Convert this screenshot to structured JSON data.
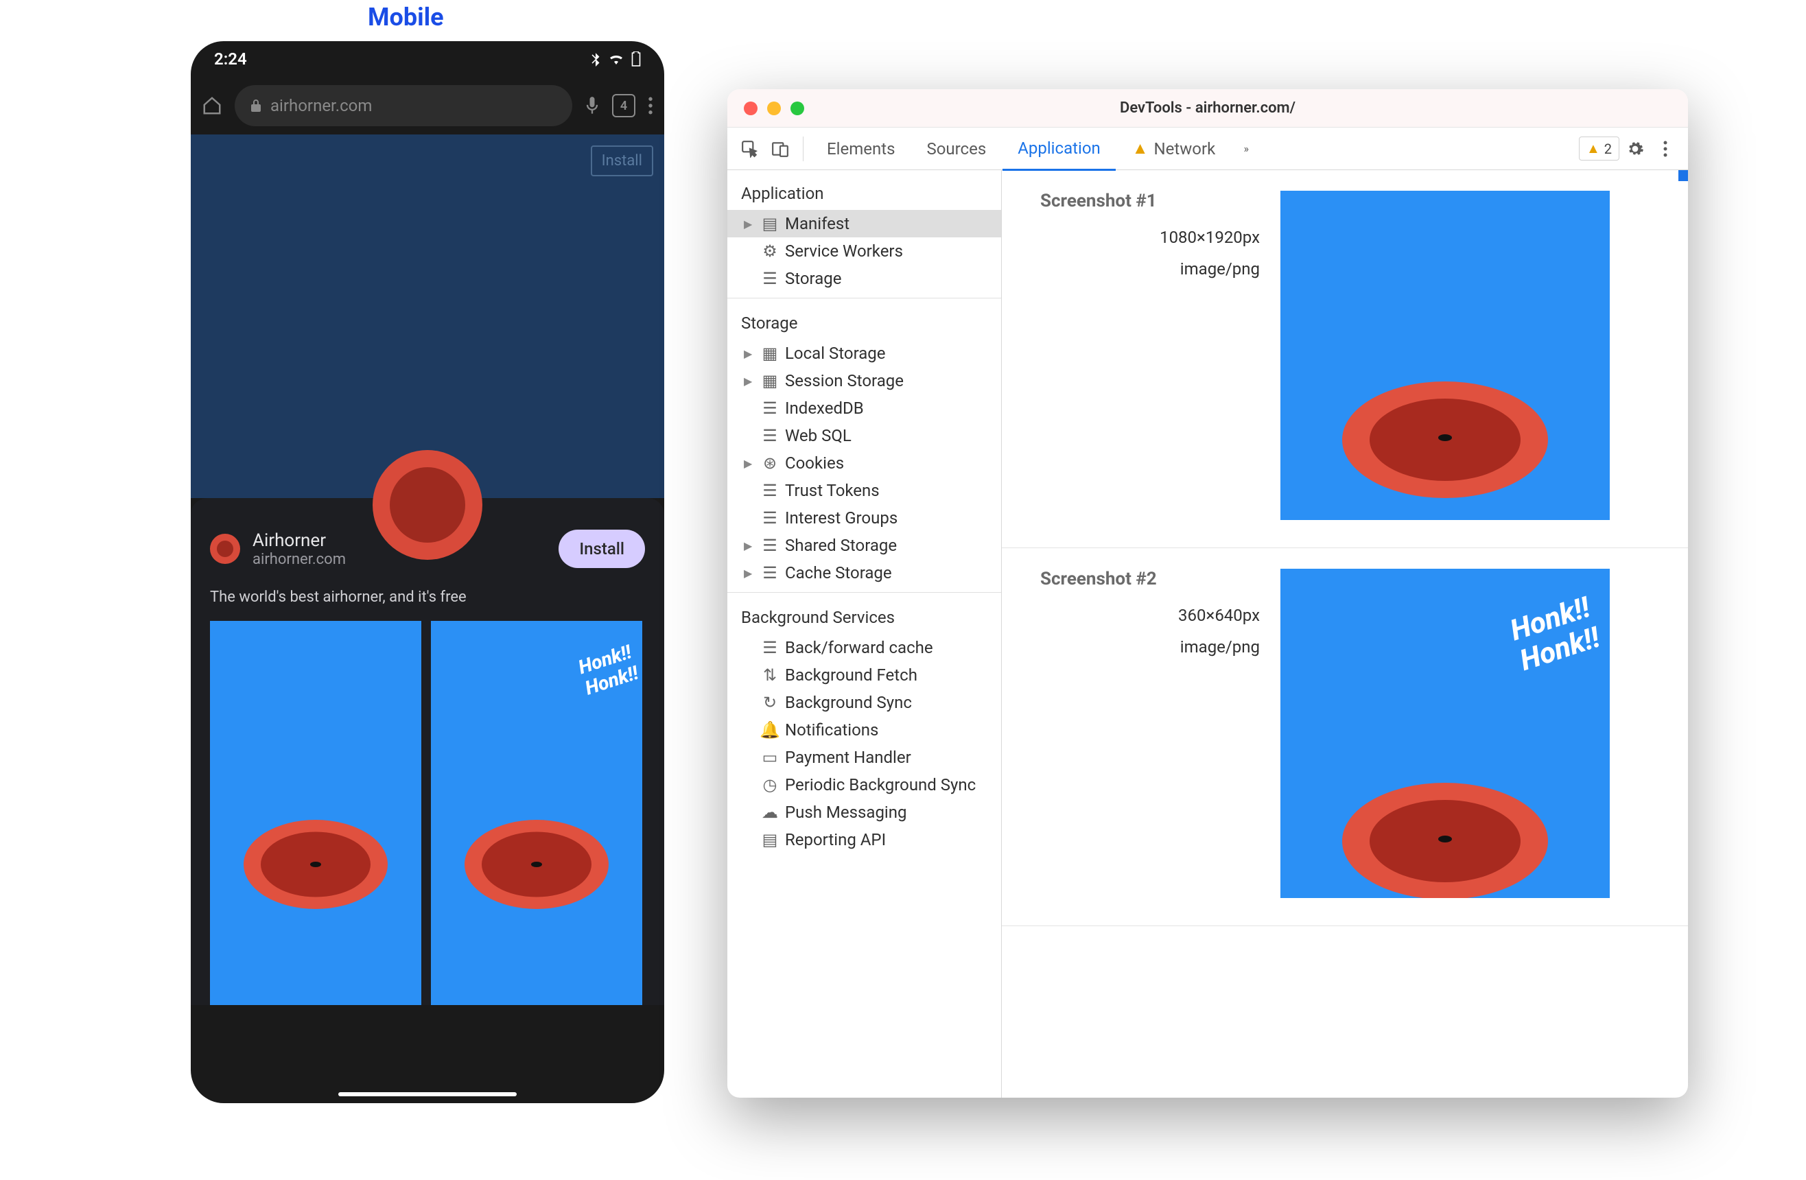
{
  "label_mobile": "Mobile",
  "mobile": {
    "time": "2:24",
    "url": "airhorner.com",
    "tab_count": "4",
    "page_install_chip": "Install",
    "sheet": {
      "title": "Airhorner",
      "subtitle": "airhorner.com",
      "install_btn": "Install",
      "description": "The world's best airhorner, and it's free",
      "honk_text": "Honk!!\nHonk!!"
    }
  },
  "devtools": {
    "window_title": "DevTools - airhorner.com/",
    "tabs": {
      "elements": "Elements",
      "sources": "Sources",
      "application": "Application",
      "network": "Network"
    },
    "badge_count": "2",
    "sidebar": {
      "sec_application": "Application",
      "manifest": "Manifest",
      "service_workers": "Service Workers",
      "storage_item": "Storage",
      "sec_storage": "Storage",
      "local_storage": "Local Storage",
      "session_storage": "Session Storage",
      "indexeddb": "IndexedDB",
      "web_sql": "Web SQL",
      "cookies": "Cookies",
      "trust_tokens": "Trust Tokens",
      "interest_groups": "Interest Groups",
      "shared_storage": "Shared Storage",
      "cache_storage": "Cache Storage",
      "sec_background": "Background Services",
      "bf_cache": "Back/forward cache",
      "bg_fetch": "Background Fetch",
      "bg_sync": "Background Sync",
      "notifications": "Notifications",
      "payment_handler": "Payment Handler",
      "periodic_bg": "Periodic Background Sync",
      "push_msg": "Push Messaging",
      "reporting_api": "Reporting API"
    },
    "main": {
      "shot1_title": "Screenshot #1",
      "shot1_dim": "1080×1920px",
      "shot1_mime": "image/png",
      "shot2_title": "Screenshot #2",
      "shot2_dim": "360×640px",
      "shot2_mime": "image/png",
      "honk_text": "Honk!!\nHonk!!"
    }
  }
}
